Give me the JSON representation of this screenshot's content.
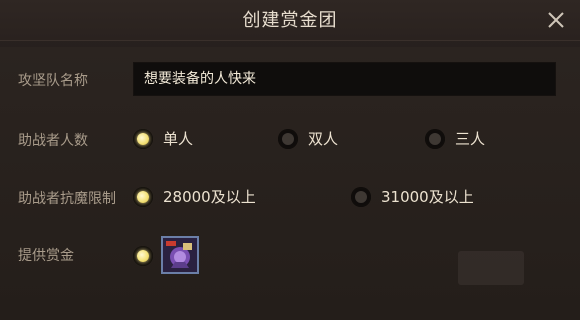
{
  "dialog": {
    "title": "创建赏金团",
    "close_icon": "close-icon"
  },
  "team_name": {
    "label": "攻坚队名称",
    "value": "想要装备的人快来"
  },
  "helper_count": {
    "label": "助战者人数",
    "options": [
      {
        "label": "单人",
        "selected": true
      },
      {
        "label": "双人",
        "selected": false
      },
      {
        "label": "三人",
        "selected": false
      }
    ]
  },
  "resist_limit": {
    "label": "助战者抗魔限制",
    "options": [
      {
        "label": "28000及以上",
        "selected": true
      },
      {
        "label": "31000及以上",
        "selected": false
      }
    ]
  },
  "reward": {
    "label": "提供赏金",
    "selected": true,
    "item_icon": "reward-item-icon"
  },
  "colors": {
    "accent_selected": "#f4e27a",
    "text_label": "#a99c8b",
    "text_value": "#ece2d0"
  }
}
